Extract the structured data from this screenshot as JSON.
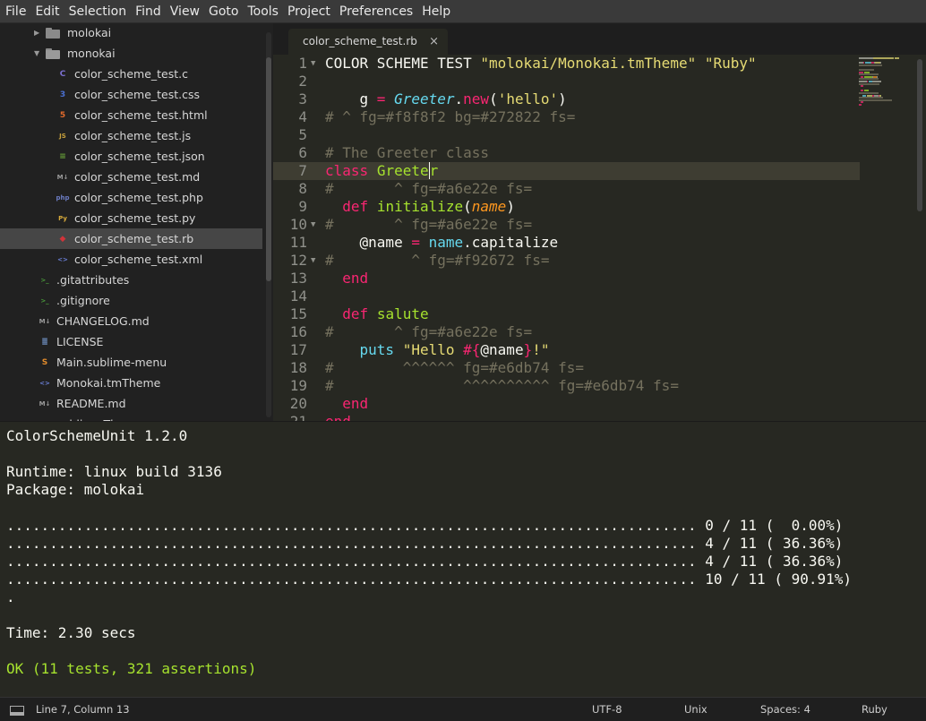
{
  "menu": [
    "File",
    "Edit",
    "Selection",
    "Find",
    "View",
    "Goto",
    "Tools",
    "Project",
    "Preferences",
    "Help"
  ],
  "sidebar": {
    "items": [
      {
        "label": "molokai",
        "kind": "folder",
        "icon": "folder-icon",
        "open": false
      },
      {
        "label": "monokai",
        "kind": "folder",
        "icon": "folder-open-icon",
        "open": true
      },
      {
        "label": "color_scheme_test.c",
        "icon": "c-file-icon",
        "glyph": "C",
        "color": "#7b6fd0"
      },
      {
        "label": "color_scheme_test.css",
        "icon": "css-file-icon",
        "glyph": "3",
        "color": "#4a6fd0"
      },
      {
        "label": "color_scheme_test.html",
        "icon": "html-file-icon",
        "glyph": "5",
        "color": "#e06a2c"
      },
      {
        "label": "color_scheme_test.js",
        "icon": "js-file-icon",
        "glyph": "JS",
        "color": "#c7a03c"
      },
      {
        "label": "color_scheme_test.json",
        "icon": "json-file-icon",
        "glyph": "≡",
        "color": "#6aa23a"
      },
      {
        "label": "color_scheme_test.md",
        "icon": "markdown-file-icon",
        "glyph": "M↓",
        "color": "#9a9a9a"
      },
      {
        "label": "color_scheme_test.php",
        "icon": "php-file-icon",
        "glyph": "php",
        "color": "#6b7bc2"
      },
      {
        "label": "color_scheme_test.py",
        "icon": "python-file-icon",
        "glyph": "Py",
        "color": "#d4a83a"
      },
      {
        "label": "color_scheme_test.rb",
        "icon": "ruby-file-icon",
        "glyph": "◆",
        "color": "#d0343a"
      },
      {
        "label": "color_scheme_test.xml",
        "icon": "xml-file-icon",
        "glyph": "<>",
        "color": "#6a7fd8"
      },
      {
        "label": ".gitattributes",
        "icon": "terminal-file-icon",
        "glyph": ">_",
        "color": "#4a9a3a"
      },
      {
        "label": ".gitignore",
        "icon": "terminal-file-icon",
        "glyph": ">_",
        "color": "#4a9a3a"
      },
      {
        "label": "CHANGELOG.md",
        "icon": "markdown-file-icon",
        "glyph": "M↓",
        "color": "#9a9a9a"
      },
      {
        "label": "LICENSE",
        "icon": "license-file-icon",
        "glyph": "≣",
        "color": "#7aa0d8"
      },
      {
        "label": "Main.sublime-menu",
        "icon": "sublime-file-icon",
        "glyph": "S",
        "color": "#e08a2c"
      },
      {
        "label": "Monokai.tmTheme",
        "icon": "xml-file-icon",
        "glyph": "<>",
        "color": "#6a7fd8"
      },
      {
        "label": "README.md",
        "icon": "markdown-file-icon",
        "glyph": "M↓",
        "color": "#9a9a9a"
      },
      {
        "label": "sublime-Th...",
        "icon": "file-icon",
        "glyph": "",
        "color": "#9a9a9a"
      }
    ],
    "selected_index": 10
  },
  "tab": {
    "label": "color_scheme_test.rb",
    "close": "×"
  },
  "editor": {
    "current_line": 7,
    "lines": [
      {
        "n": "1",
        "fold": "▼",
        "code": [
          [
            "",
            "COLOR SCHEME TEST "
          ],
          [
            "c-str",
            "\"molokai/Monokai.tmTheme\""
          ],
          [
            "",
            " "
          ],
          [
            "c-str",
            "\"Ruby\""
          ]
        ]
      },
      {
        "n": "2",
        "code": []
      },
      {
        "n": "3",
        "code": [
          [
            "",
            "    g "
          ],
          [
            "c-kw",
            "="
          ],
          [
            "",
            " "
          ],
          [
            "c-ital",
            "Greeter"
          ],
          [
            "",
            "."
          ],
          [
            "c-kw",
            "new"
          ],
          [
            "",
            "("
          ],
          [
            "c-str",
            "'hello'"
          ],
          [
            "",
            ")"
          ]
        ]
      },
      {
        "n": "4",
        "code": [
          [
            "c-cmt",
            "# ^ fg=#f8f8f2 bg=#272822 fs="
          ]
        ]
      },
      {
        "n": "5",
        "code": []
      },
      {
        "n": "6",
        "code": [
          [
            "c-cmt",
            "# The Greeter class"
          ]
        ]
      },
      {
        "n": "7",
        "code": [
          [
            "c-kw",
            "class"
          ],
          [
            "",
            " "
          ],
          [
            "c-fn",
            "Greete"
          ],
          [
            "c-fn caret",
            "r"
          ]
        ]
      },
      {
        "n": "8",
        "code": [
          [
            "c-cmt",
            "#       ^ fg=#a6e22e fs="
          ]
        ]
      },
      {
        "n": "9",
        "code": [
          [
            "",
            "  "
          ],
          [
            "c-kw",
            "def"
          ],
          [
            "",
            " "
          ],
          [
            "c-fn",
            "initialize"
          ],
          [
            "",
            "("
          ],
          [
            "c-param",
            "name"
          ],
          [
            "",
            ")"
          ]
        ]
      },
      {
        "n": "10",
        "fold": "▼",
        "code": [
          [
            "c-cmt",
            "#       ^ fg=#a6e22e fs="
          ]
        ]
      },
      {
        "n": "11",
        "code": [
          [
            "",
            "    @name "
          ],
          [
            "c-kw",
            "="
          ],
          [
            "",
            " "
          ],
          [
            "c-bl",
            "name"
          ],
          [
            "",
            ".capitalize"
          ]
        ]
      },
      {
        "n": "12",
        "fold": "▼",
        "code": [
          [
            "c-cmt",
            "#         ^ fg=#f92672 fs="
          ]
        ]
      },
      {
        "n": "13",
        "code": [
          [
            "",
            "  "
          ],
          [
            "c-kw",
            "end"
          ]
        ]
      },
      {
        "n": "14",
        "code": []
      },
      {
        "n": "15",
        "code": [
          [
            "",
            "  "
          ],
          [
            "c-kw",
            "def"
          ],
          [
            "",
            " "
          ],
          [
            "c-fn",
            "salute"
          ]
        ]
      },
      {
        "n": "16",
        "code": [
          [
            "c-cmt",
            "#       ^ fg=#a6e22e fs="
          ]
        ]
      },
      {
        "n": "17",
        "code": [
          [
            "",
            "    "
          ],
          [
            "c-bl",
            "puts"
          ],
          [
            "",
            " "
          ],
          [
            "c-str",
            "\"Hello "
          ],
          [
            "c-kw",
            "#{"
          ],
          [
            "",
            "@name"
          ],
          [
            "c-kw",
            "}"
          ],
          [
            "c-str",
            "!\""
          ]
        ]
      },
      {
        "n": "18",
        "code": [
          [
            "c-cmt",
            "#        ^^^^^^ fg=#e6db74 fs="
          ]
        ]
      },
      {
        "n": "19",
        "code": [
          [
            "c-cmt",
            "#               ^^^^^^^^^^ fg=#e6db74 fs="
          ]
        ]
      },
      {
        "n": "20",
        "code": [
          [
            "",
            "  "
          ],
          [
            "c-kw",
            "end"
          ]
        ]
      },
      {
        "n": "21",
        "code": [
          [
            "c-kw",
            "end"
          ]
        ]
      }
    ]
  },
  "output": {
    "lines": [
      "ColorSchemeUnit 1.2.0",
      "",
      "Runtime: linux build 3136",
      "Package: molokai",
      "",
      "................................................................................ 0 / 11 (  0.00%)",
      "................................................................................ 4 / 11 ( 36.36%)",
      "................................................................................ 4 / 11 ( 36.36%)",
      "................................................................................ 10 / 11 ( 90.91%)",
      ".",
      "",
      "Time: 2.30 secs",
      "",
      "OK (11 tests, 321 assertions)"
    ],
    "ok_index": 13
  },
  "status": {
    "position": "Line 7, Column 13",
    "encoding": "UTF-8",
    "line_endings": "Unix",
    "indent": "Spaces: 4",
    "syntax": "Ruby"
  }
}
